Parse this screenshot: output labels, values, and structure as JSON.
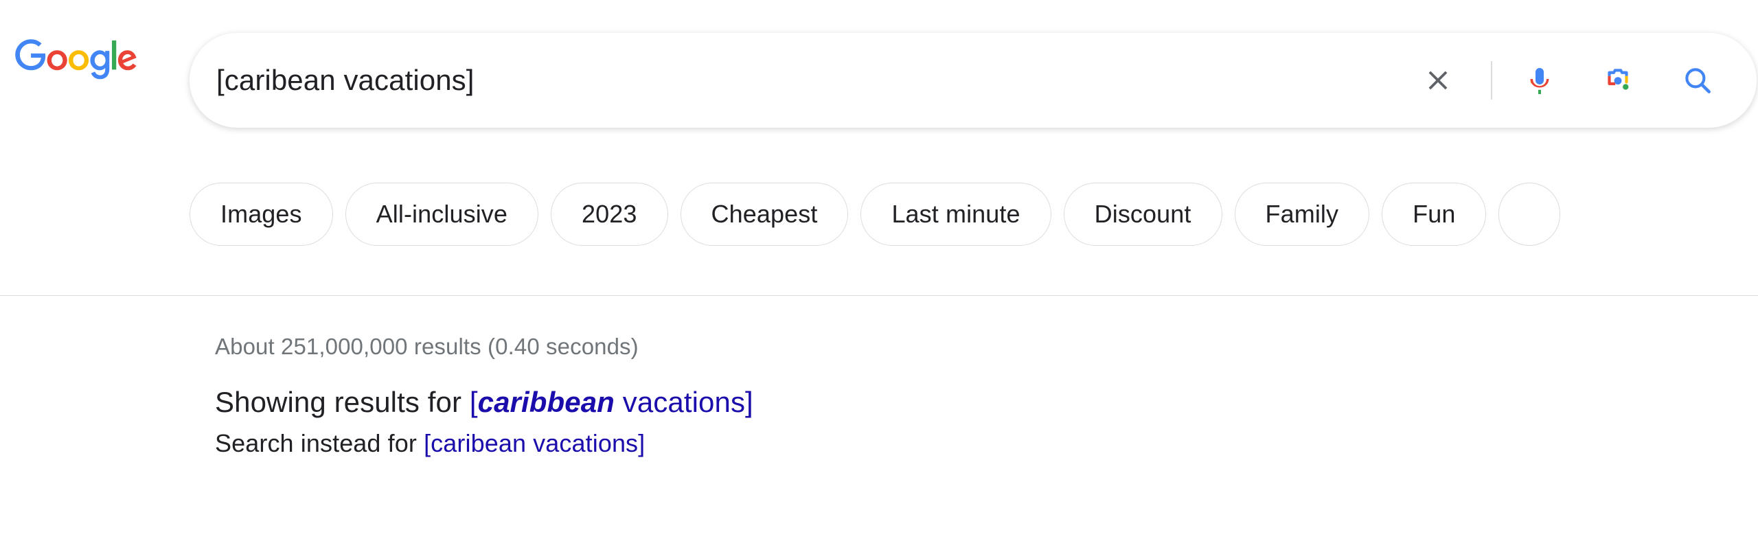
{
  "header": {
    "logo": {
      "name": "google-logo",
      "letters": [
        "G",
        "o",
        "o",
        "g",
        "l",
        "e"
      ],
      "colors": {
        "blue": "#4285F4",
        "red": "#EA4335",
        "yellow": "#FBBC05",
        "green": "#34A853"
      }
    },
    "search": {
      "value": "[caribean vacations]",
      "placeholder": "Search",
      "icons": {
        "clear": "close-icon",
        "voice": "microphone-icon",
        "lens": "google-lens-icon",
        "submit": "search-icon"
      }
    },
    "chips": [
      {
        "label": "Images"
      },
      {
        "label": "All-inclusive"
      },
      {
        "label": "2023"
      },
      {
        "label": "Cheapest"
      },
      {
        "label": "Last minute"
      },
      {
        "label": "Discount"
      },
      {
        "label": "Family"
      },
      {
        "label": "Fun"
      },
      {
        "label": ""
      }
    ]
  },
  "main": {
    "result_stats": "About 251,000,000 results (0.40 seconds)",
    "spelling": {
      "showing_prefix": "Showing results for ",
      "showing_open_bracket": "[",
      "showing_corrected_word": "caribbean",
      "showing_rest": " vacations]",
      "instead_prefix": "Search instead for ",
      "instead_query": "[caribean vacations]"
    }
  },
  "colors": {
    "link": "#1a0dab",
    "text": "#202124",
    "muted": "#70757a",
    "border": "#dadce0",
    "google_blue": "#4285F4",
    "google_red": "#EA4335",
    "google_yellow": "#FBBC05",
    "google_green": "#34A853"
  }
}
